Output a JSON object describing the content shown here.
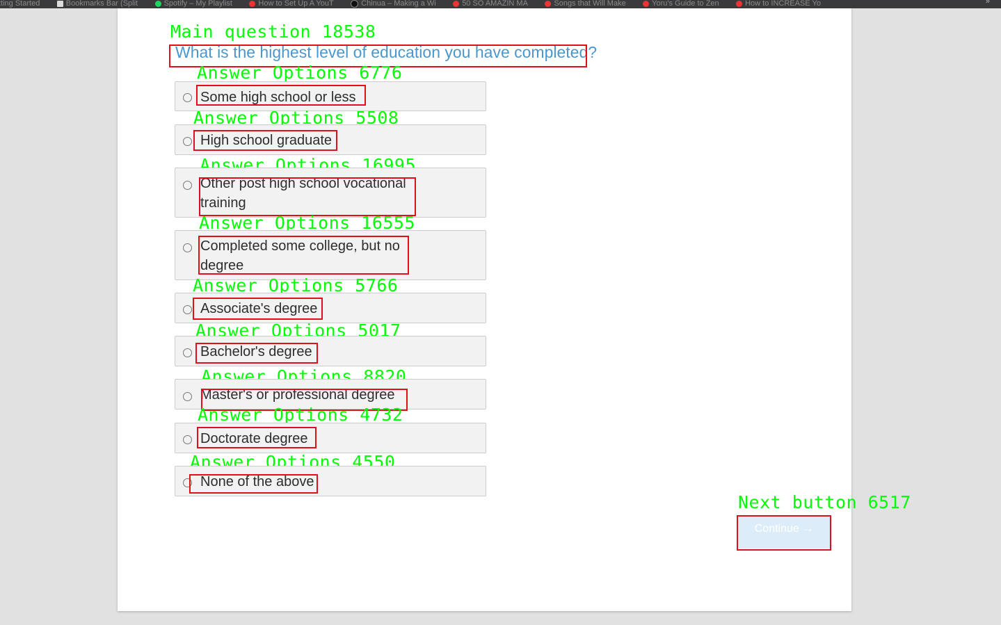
{
  "browser": {
    "bookmarks": [
      {
        "label": "tting Started",
        "icon": "none"
      },
      {
        "label": "Bookmarks Bar (Split",
        "icon": "folder-icon"
      },
      {
        "label": "Spotify – My Playlist",
        "icon": "spotify-icon"
      },
      {
        "label": "How to Set Up A YouT",
        "icon": "youtube-icon"
      },
      {
        "label": "Chinua – Making a Wi",
        "icon": "github-icon"
      },
      {
        "label": "50 SO AMAZIN MA",
        "icon": "youtube-icon"
      },
      {
        "label": "Songs that Will Make",
        "icon": "youtube-icon"
      },
      {
        "label": "Yoru's Guide to Zen",
        "icon": "youtube-icon"
      },
      {
        "label": "How to INCREASE Yo",
        "icon": "youtube-icon"
      }
    ],
    "overflow_label": "»"
  },
  "survey": {
    "question_annotation": "Main question 18538",
    "question": "What is the highest level of education you have completed?",
    "options": [
      {
        "annotation": "Answer Options 6776",
        "label": "Some high school or less"
      },
      {
        "annotation": "Answer Options 5508",
        "label": "High school graduate"
      },
      {
        "annotation": "Answer Options 16995",
        "label": "Other post high school vocational training"
      },
      {
        "annotation": "Answer Options 16555",
        "label": "Completed some college, but no degree"
      },
      {
        "annotation": "Answer Options 5766",
        "label": "Associate's degree"
      },
      {
        "annotation": "Answer Options 5017",
        "label": "Bachelor's degree"
      },
      {
        "annotation": "Answer Options 8820",
        "label": "Master's or professional degree"
      },
      {
        "annotation": "Answer Options 4732",
        "label": "Doctorate degree"
      },
      {
        "annotation": "Answer Options 4550",
        "label": "None of the above"
      }
    ],
    "next_annotation": "Next button 6517",
    "next_label": "Continue →"
  },
  "colors": {
    "annotation_text": "#00ff00",
    "annotation_box": "#e0101a",
    "question_text": "#4a97cf",
    "option_background": "#f2f2f2",
    "continue_background": "#dcecf8"
  }
}
